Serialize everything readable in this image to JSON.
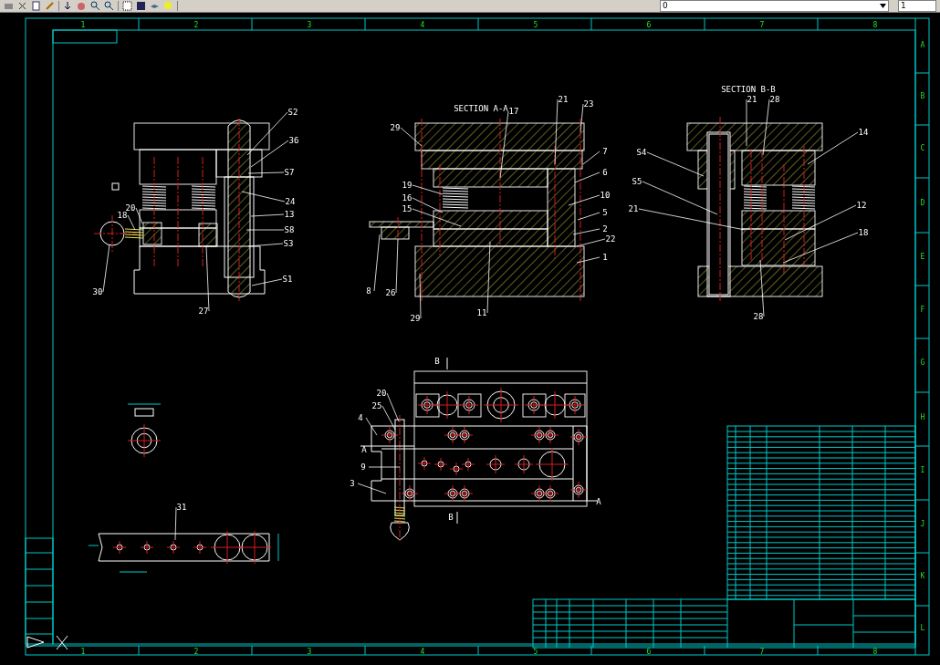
{
  "toolbar": {
    "layer": "0",
    "field": "1"
  },
  "border": {
    "top_columns": [
      "1",
      "2",
      "3",
      "4",
      "5",
      "6",
      "7",
      "8"
    ],
    "bottom_columns": [
      "1",
      "2",
      "3",
      "4",
      "5",
      "6",
      "7",
      "8"
    ],
    "rows": [
      "A",
      "B",
      "C",
      "D",
      "E",
      "F",
      "G",
      "H",
      "I",
      "J",
      "K",
      "L"
    ]
  },
  "front_view": {
    "labels": [
      "S2",
      "36",
      "S7",
      "24",
      "13",
      "S8",
      "S3",
      "S1",
      "30",
      "18",
      "20",
      "27"
    ]
  },
  "section_a": {
    "title": "SECTION A-A",
    "labels": [
      "17",
      "21",
      "23",
      "29",
      "7",
      "6",
      "19",
      "10",
      "16",
      "15",
      "5",
      "2",
      "22",
      "1",
      "8",
      "26",
      "29",
      "11"
    ]
  },
  "section_b": {
    "title": "SECTION B-B",
    "labels": [
      "21",
      "28",
      "14",
      "S4",
      "S5",
      "21",
      "12",
      "18",
      "28"
    ]
  },
  "top_view": {
    "labels": [
      "B",
      "B",
      "A",
      "A",
      "25",
      "20",
      "4",
      "9",
      "3"
    ]
  },
  "strip_layout": {
    "labels": [
      "31"
    ]
  }
}
